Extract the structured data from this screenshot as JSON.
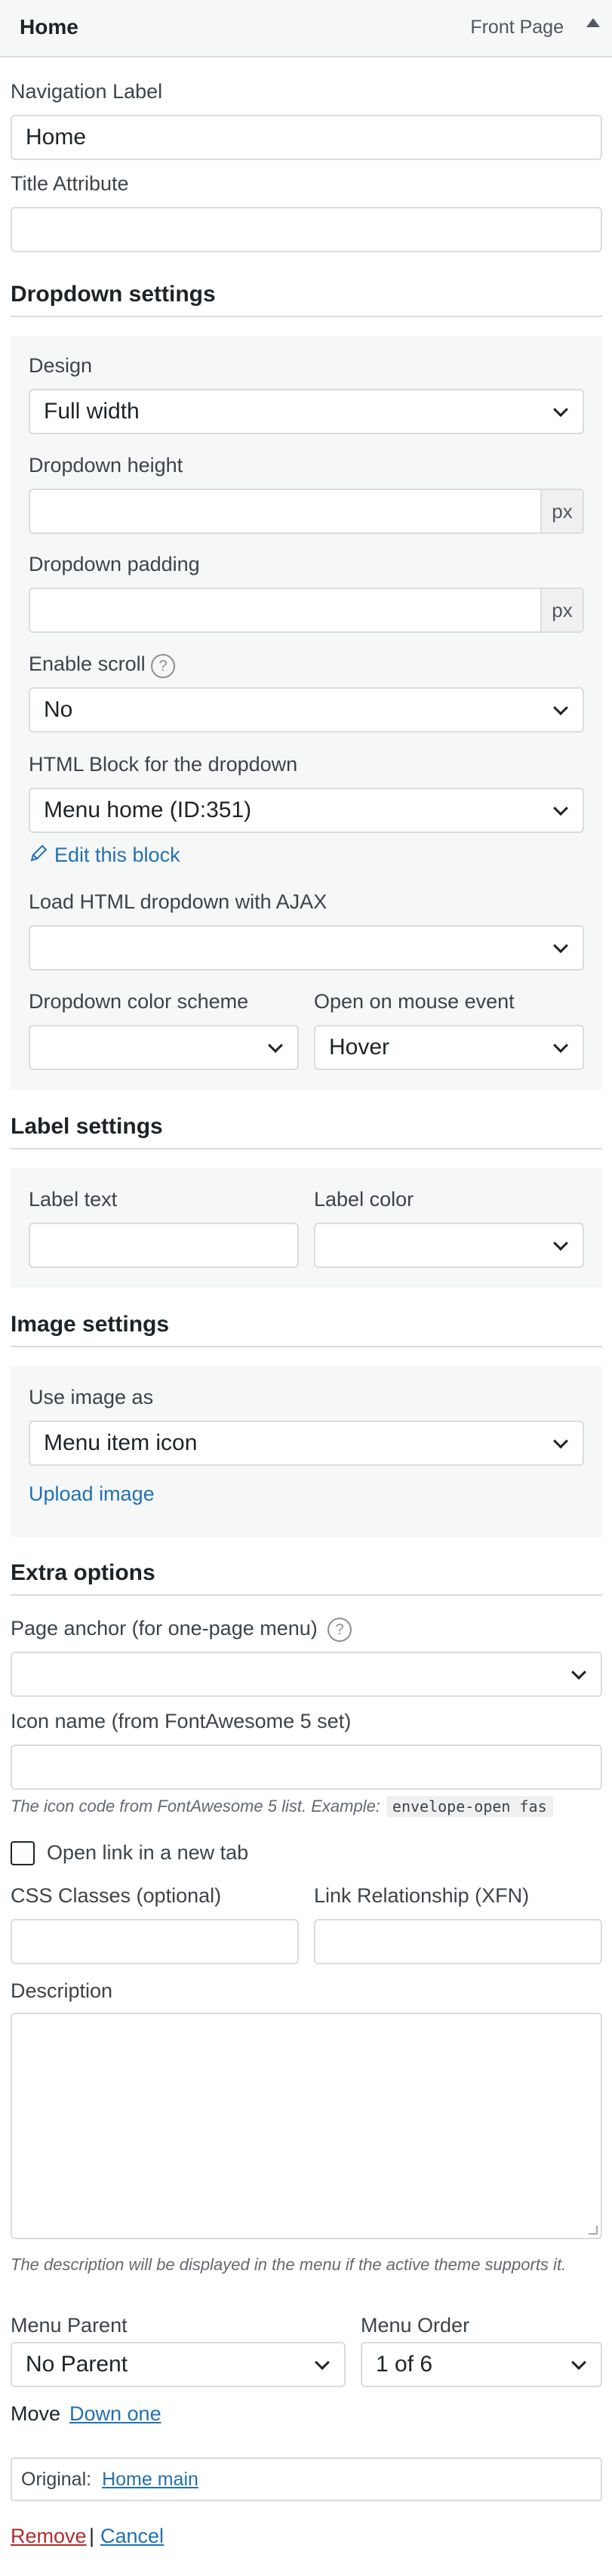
{
  "header": {
    "title": "Home",
    "item_type": "Front Page"
  },
  "navigation_label": {
    "label": "Navigation Label",
    "value": "Home"
  },
  "title_attribute": {
    "label": "Title Attribute",
    "value": ""
  },
  "dropdown_settings": {
    "title": "Dropdown settings",
    "design": {
      "label": "Design",
      "value": "Full width"
    },
    "height": {
      "label": "Dropdown height",
      "unit": "px",
      "value": ""
    },
    "padding": {
      "label": "Dropdown padding",
      "unit": "px",
      "value": ""
    },
    "scroll": {
      "label": "Enable scroll",
      "value": "No"
    },
    "html_block": {
      "label": "HTML Block for the dropdown",
      "value": "Menu home (ID:351)"
    },
    "edit_link": "Edit this block",
    "ajax": {
      "label": "Load HTML dropdown with AJAX",
      "value": ""
    },
    "color_scheme": {
      "label": "Dropdown color scheme",
      "value": ""
    },
    "mouse_event": {
      "label": "Open on mouse event",
      "value": "Hover"
    }
  },
  "label_settings": {
    "title": "Label settings",
    "label_text": {
      "label": "Label text",
      "value": ""
    },
    "label_color": {
      "label": "Label color",
      "value": ""
    }
  },
  "image_settings": {
    "title": "Image settings",
    "use_image_as": {
      "label": "Use image as",
      "value": "Menu item icon"
    },
    "upload_link": "Upload image"
  },
  "extra_options": {
    "title": "Extra options",
    "page_anchor": {
      "label": "Page anchor (for one-page menu)",
      "value": ""
    },
    "icon_name": {
      "label": "Icon name (from FontAwesome 5 set)",
      "value": ""
    },
    "icon_hint": "The icon code from FontAwesome 5 list. Example:",
    "icon_hint_code": "envelope-open fas"
  },
  "open_new_tab": {
    "label": "Open link in a new tab",
    "checked": false
  },
  "css_classes": {
    "label": "CSS Classes (optional)",
    "value": ""
  },
  "link_relationship": {
    "label": "Link Relationship (XFN)",
    "value": ""
  },
  "description": {
    "label": "Description",
    "value": "",
    "hint": "The description will be displayed in the menu if the active theme supports it."
  },
  "menu_parent": {
    "label": "Menu Parent",
    "value": "No Parent"
  },
  "menu_order": {
    "label": "Menu Order",
    "value": "1 of 6"
  },
  "move": {
    "label": "Move",
    "link": "Down one"
  },
  "original": {
    "label": "Original:",
    "link": "Home main"
  },
  "actions": {
    "remove": "Remove",
    "separator": "|",
    "cancel": "Cancel"
  },
  "icons": [
    "collapse-arrow-icon",
    "chevron-down-icon",
    "help-icon",
    "pencil-icon",
    "resize-handle-icon"
  ]
}
